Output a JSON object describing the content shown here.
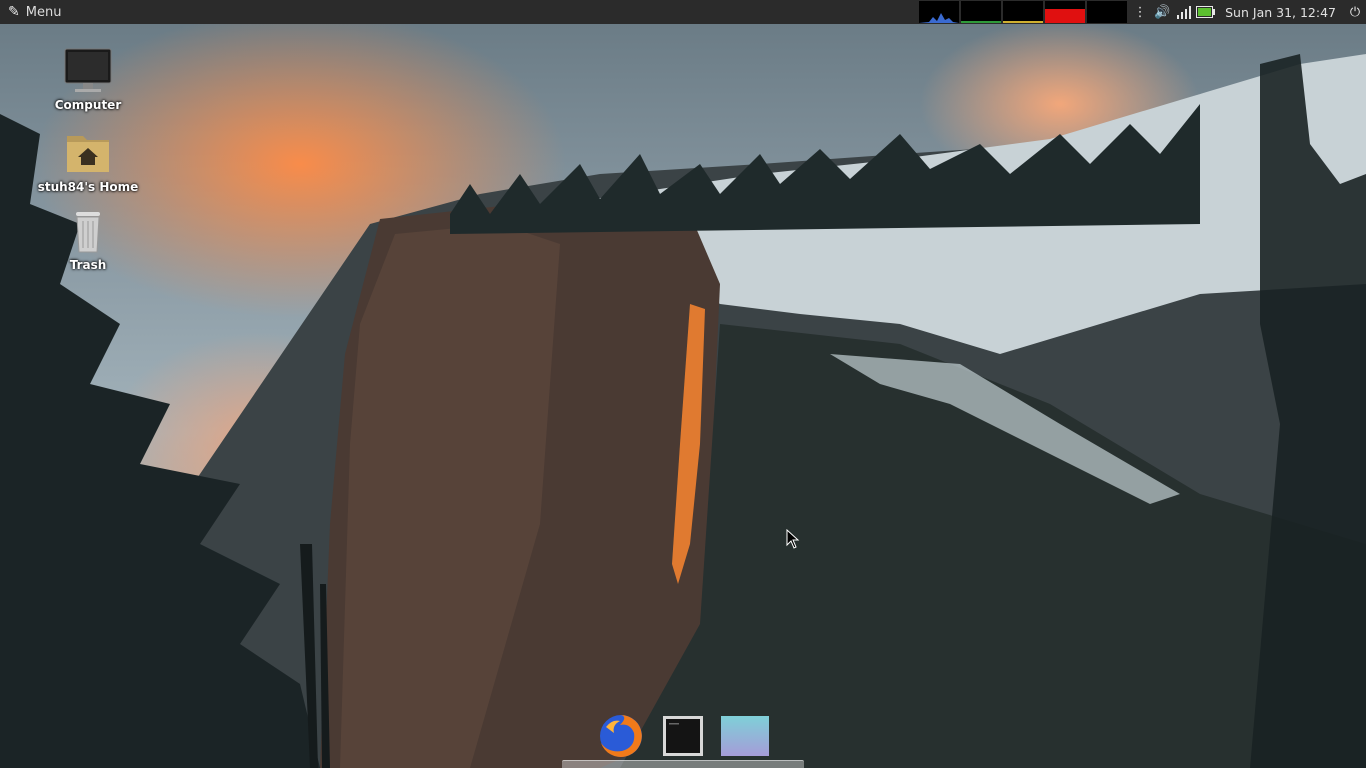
{
  "panel": {
    "menu_label": "Menu",
    "clock": "Sun Jan 31, 12:47",
    "tray_icons": [
      "more-icon",
      "volume-icon",
      "network-signal-icon",
      "battery-icon",
      "power-icon"
    ],
    "graph_colors": [
      "#3a6ad0",
      "#2f9a3a",
      "#d0b030",
      "#e01010",
      "#000000"
    ]
  },
  "desktop": {
    "icons": [
      {
        "label": "Computer",
        "icon": "monitor-icon"
      },
      {
        "label": "stuh84's Home",
        "icon": "home-folder-icon"
      },
      {
        "label": "Trash",
        "icon": "trash-icon"
      }
    ]
  },
  "dock": {
    "items": [
      {
        "name": "firefox",
        "icon": "firefox-icon"
      },
      {
        "name": "terminal",
        "icon": "terminal-icon"
      },
      {
        "name": "desktop-preview",
        "icon": "window-preview-icon"
      }
    ]
  },
  "colors": {
    "panel_bg": "#2b2b2b",
    "panel_text": "#dcdcdc"
  }
}
